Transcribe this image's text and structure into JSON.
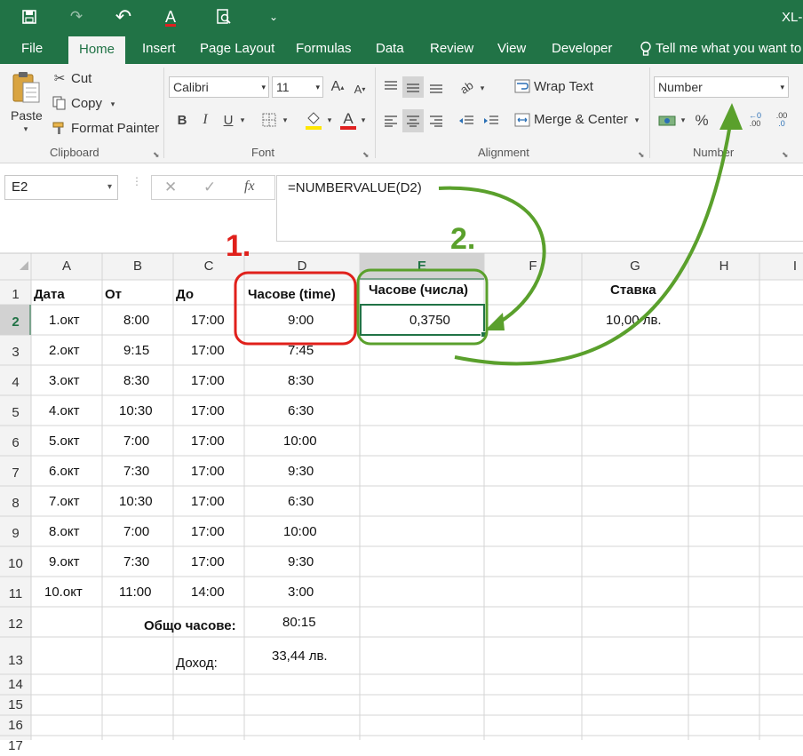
{
  "titlebar": {
    "title": "XL-",
    "undo_glyph": "↶",
    "redo_glyph": "↷",
    "font_color_glyph": "A",
    "customize_glyph": "⌄"
  },
  "tabs": [
    {
      "label": "File"
    },
    {
      "label": "Home"
    },
    {
      "label": "Insert"
    },
    {
      "label": "Page Layout"
    },
    {
      "label": "Formulas"
    },
    {
      "label": "Data"
    },
    {
      "label": "Review"
    },
    {
      "label": "View"
    },
    {
      "label": "Developer"
    },
    {
      "label": "Tell me what you want to"
    }
  ],
  "ribbon": {
    "clipboard": {
      "paste": "Paste",
      "cut": "Cut",
      "copy": "Copy",
      "format_painter": "Format Painter",
      "group": "Clipboard"
    },
    "font": {
      "name": "Calibri",
      "size": "11",
      "grow": "A",
      "shrink": "A",
      "bold": "B",
      "italic": "I",
      "underline": "U",
      "font_color": "A",
      "group": "Font"
    },
    "alignment": {
      "wrap": "Wrap Text",
      "merge": "Merge & Center",
      "group": "Alignment"
    },
    "number": {
      "format": "Number",
      "percent": "%",
      "group": "Number",
      "inc_decimal": ".00",
      "dec_decimal": ".0"
    }
  },
  "formula_bar": {
    "name_box": "E2",
    "cancel": "✕",
    "enter": "✓",
    "fx": "fx",
    "formula": "=NUMBERVALUE(D2)"
  },
  "columns": [
    "A",
    "B",
    "C",
    "D",
    "E",
    "F",
    "G",
    "H",
    "I"
  ],
  "rows": [
    "1",
    "2",
    "3",
    "4",
    "5",
    "6",
    "7",
    "8",
    "9",
    "10",
    "11",
    "12",
    "13",
    "14",
    "15",
    "16",
    "17"
  ],
  "headers": {
    "a": "Дата",
    "b": "От",
    "c": "До",
    "d": "Часове (time)",
    "e": "Часове (числа)",
    "g": "Ставка"
  },
  "data": [
    {
      "a": "1.окт",
      "b": "8:00",
      "c": "17:00",
      "d": "9:00"
    },
    {
      "a": "2.окт",
      "b": "9:15",
      "c": "17:00",
      "d": "7:45"
    },
    {
      "a": "3.окт",
      "b": "8:30",
      "c": "17:00",
      "d": "8:30"
    },
    {
      "a": "4.окт",
      "b": "10:30",
      "c": "17:00",
      "d": "6:30"
    },
    {
      "a": "5.окт",
      "b": "7:00",
      "c": "17:00",
      "d": "10:00"
    },
    {
      "a": "6.окт",
      "b": "7:30",
      "c": "17:00",
      "d": "9:30"
    },
    {
      "a": "7.окт",
      "b": "10:30",
      "c": "17:00",
      "d": "6:30"
    },
    {
      "a": "8.окт",
      "b": "7:00",
      "c": "17:00",
      "d": "10:00"
    },
    {
      "a": "9.окт",
      "b": "7:30",
      "c": "17:00",
      "d": "9:30"
    },
    {
      "a": "10.окт",
      "b": "11:00",
      "c": "14:00",
      "d": "3:00"
    }
  ],
  "e2": "0,3750",
  "g2": "10,00 лв.",
  "total_label": "Общо часове:",
  "total_value": "80:15",
  "income_label": "Доход:",
  "income_value": "33,44 лв.",
  "annotations": {
    "step1": "1.",
    "step2": "2."
  },
  "colors": {
    "green": "#217346",
    "annotation_red": "#e0201b",
    "annotation_green": "#5aa02c",
    "grid_line": "#d4d4d4"
  }
}
